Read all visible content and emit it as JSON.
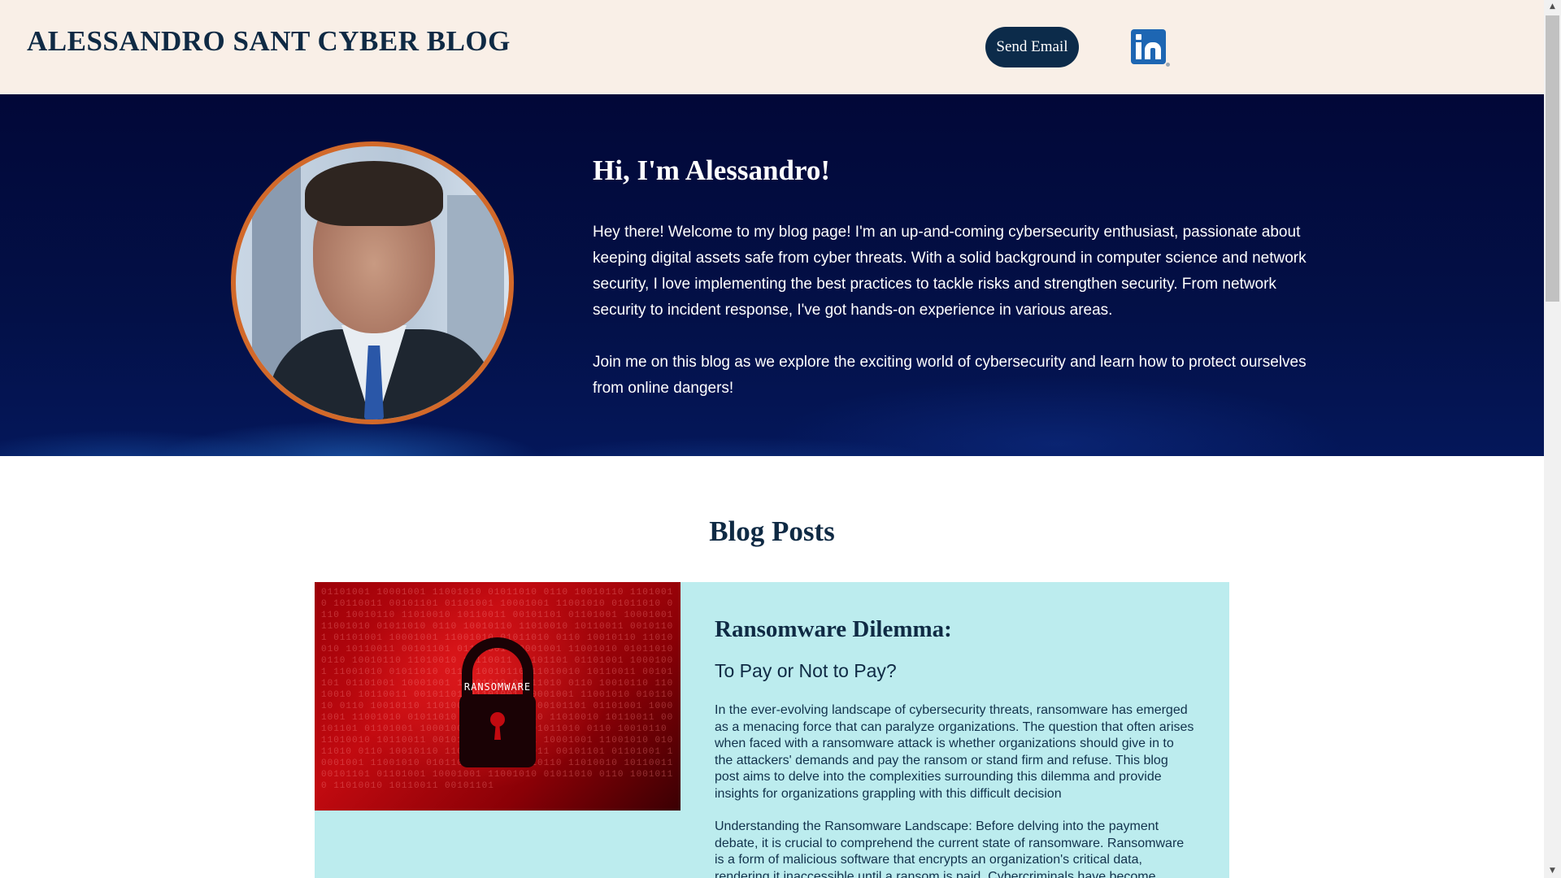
{
  "header": {
    "site_title": "ALESSANDRO SANT CYBER BLOG",
    "send_email_label": "Send Email",
    "linkedin_icon": "linkedin-icon"
  },
  "hero": {
    "heading": "Hi, I'm Alessandro!",
    "paragraphs": [
      "Hey there! Welcome to my blog page! I'm an up-and-coming cybersecurity enthusiast, passionate about keeping digital assets safe from cyber threats. With a solid background in computer science and network security, I love implementing the best practices to tackle risks and strengthen security. From network security to incident response, I've got hands-on experience in various areas.",
      "Join me on this blog as we explore the exciting world of cybersecurity and learn how to protect ourselves from online dangers!"
    ]
  },
  "blog": {
    "heading": "Blog Posts",
    "posts": [
      {
        "image_label": "RANSOMWARE",
        "title": "Ransomware Dilemma:",
        "subtitle": "To Pay or Not to Pay?",
        "paragraphs": [
          "In the ever-evolving landscape of cybersecurity threats, ransomware has emerged as a menacing force that can paralyze organizations. The question that often arises when faced with a ransomware attack is whether organizations should give in to the attackers' demands and pay the ransom or stand firm and refuse. This blog post aims to delve into the complexities surrounding this dilemma and provide insights for organizations grappling with this difficult decision",
          "Understanding the Ransomware Landscape: Before delving into the payment debate, it is crucial to comprehend the current state of ransomware. Ransomware is a form of malicious software that encrypts an organization's critical data, rendering it inaccessible until a ransom is paid. Cybercriminals have become increasingly"
        ]
      }
    ]
  },
  "colors": {
    "header_bg": "#f9efe7",
    "title_color": "#0f2a44",
    "button_bg": "#0c2b4a",
    "hero_bg": "#020838",
    "avatar_border": "#d2692a",
    "card_bg": "#bcecee",
    "linkedin_blue": "#1d66b3"
  }
}
